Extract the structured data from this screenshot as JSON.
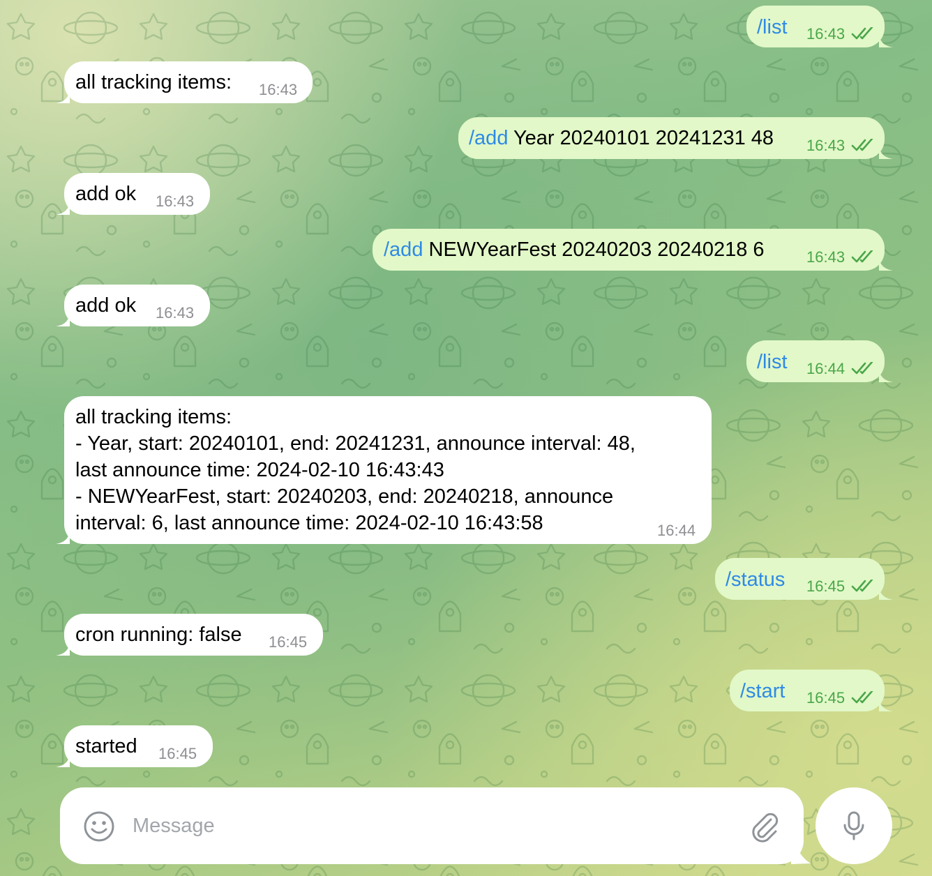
{
  "messages": [
    {
      "direction": "outgoing",
      "command": "/list",
      "text": "",
      "time": "16:43",
      "status_icon": "double-check-icon"
    },
    {
      "direction": "incoming",
      "lines": [
        "all tracking items:"
      ],
      "time": "16:43"
    },
    {
      "direction": "outgoing",
      "command": "/add",
      "text": " Year 20240101 20241231 48",
      "time": "16:43",
      "status_icon": "double-check-icon"
    },
    {
      "direction": "incoming",
      "lines": [
        "add ok"
      ],
      "time": "16:43"
    },
    {
      "direction": "outgoing",
      "command": "/add",
      "text": " NEWYearFest 20240203 20240218 6",
      "time": "16:43",
      "status_icon": "double-check-icon"
    },
    {
      "direction": "incoming",
      "lines": [
        "add ok"
      ],
      "time": "16:43"
    },
    {
      "direction": "outgoing",
      "command": "/list",
      "text": "",
      "time": "16:44",
      "status_icon": "double-check-icon"
    },
    {
      "direction": "incoming",
      "lines": [
        "all tracking items:",
        "- Year, start: 20240101, end: 20241231, announce interval: 48,",
        "last announce time: 2024-02-10 16:43:43",
        "- NEWYearFest, start: 20240203, end: 20240218, announce",
        "interval: 6, last announce time: 2024-02-10 16:43:58"
      ],
      "time": "16:44"
    },
    {
      "direction": "outgoing",
      "command": "/status",
      "text": "",
      "time": "16:45",
      "status_icon": "double-check-icon"
    },
    {
      "direction": "incoming",
      "lines": [
        "cron running: false"
      ],
      "time": "16:45"
    },
    {
      "direction": "outgoing",
      "command": "/start",
      "text": "",
      "time": "16:45",
      "status_icon": "double-check-icon"
    },
    {
      "direction": "incoming",
      "lines": [
        "started"
      ],
      "time": "16:45"
    }
  ],
  "composer": {
    "placeholder": "Message",
    "value": "",
    "emoji_icon": "emoji-smile-icon",
    "attach_icon": "paperclip-icon",
    "send_icon": "microphone-icon"
  },
  "colors": {
    "outgoing_bubble": "#e2f8c8",
    "incoming_bubble": "#ffffff",
    "command_link": "#2e8ae6",
    "outgoing_time": "#4aa64a",
    "incoming_time": "#8e8e93"
  }
}
